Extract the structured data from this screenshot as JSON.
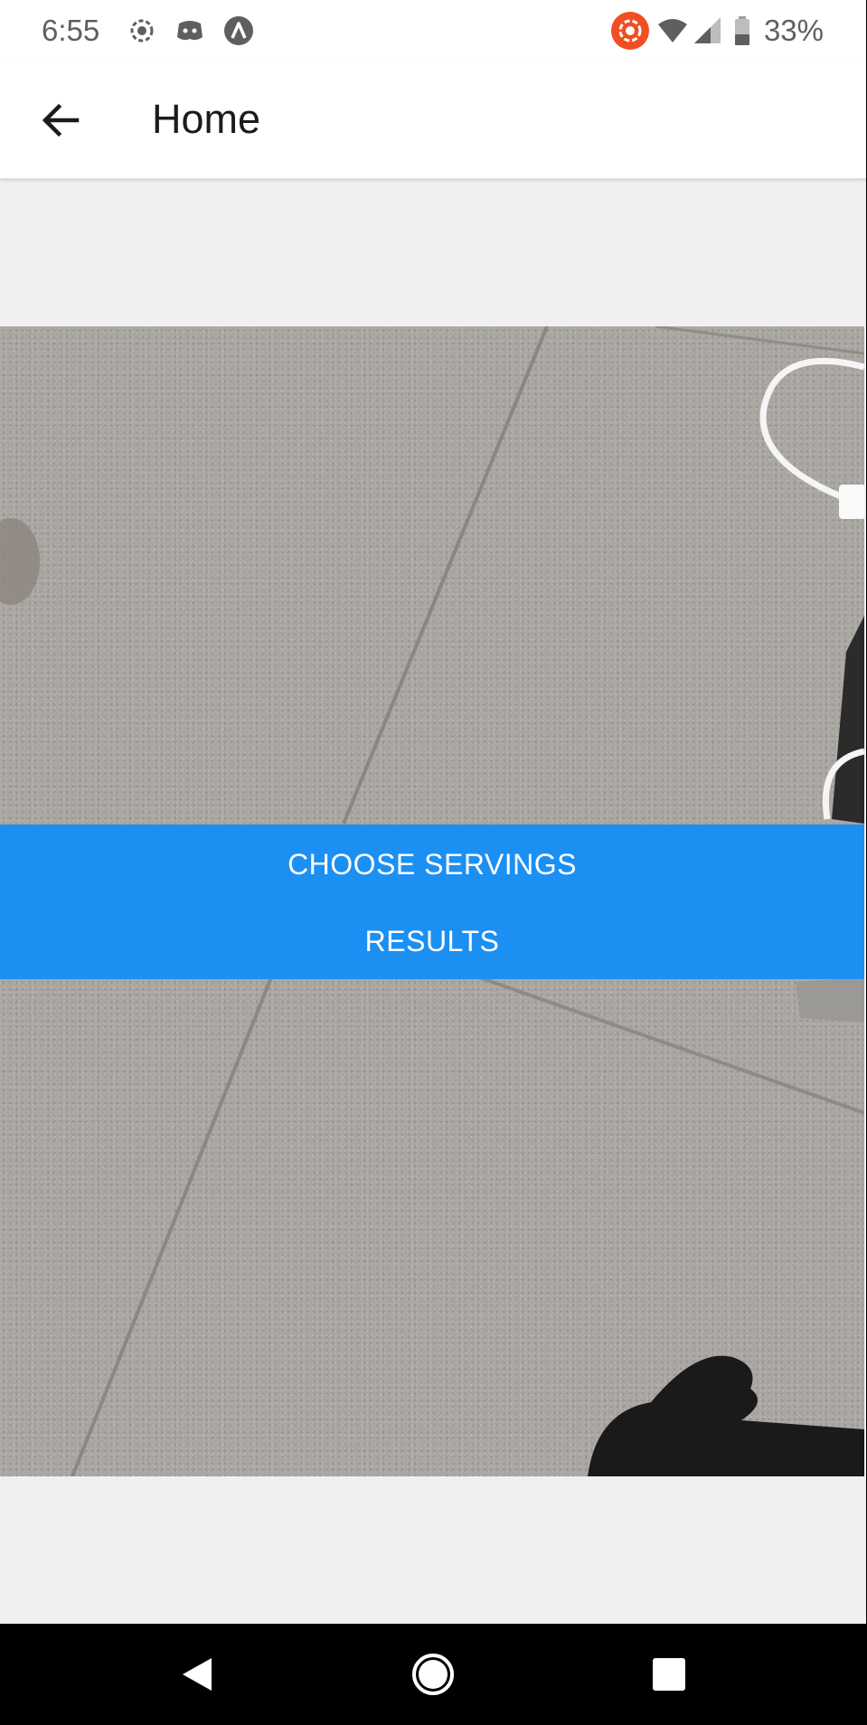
{
  "status_bar": {
    "time": "6:55",
    "battery_percent": "33%",
    "left_icons": [
      "screen-record-icon",
      "discord-icon",
      "autodesk-icon"
    ],
    "right_icons": [
      "cast-icon",
      "wifi-icon",
      "cell-signal-icon",
      "battery-icon"
    ]
  },
  "app_bar": {
    "title": "Home",
    "back_icon": "arrow-back-icon"
  },
  "actions": {
    "choose_servings_label": "CHOOSE SERVINGS",
    "results_label": "RESULTS"
  },
  "nav_bar": {
    "buttons": [
      "back-triangle-icon",
      "home-circle-icon",
      "recents-square-icon"
    ]
  },
  "colors": {
    "accent_blue": "#1c8ff3",
    "background": "#f0f0f0",
    "cast_red": "#f04e23"
  }
}
